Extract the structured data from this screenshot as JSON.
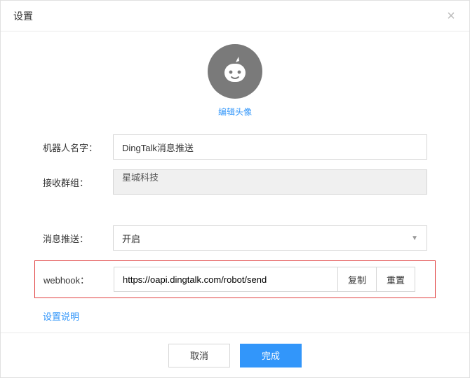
{
  "dialog": {
    "title": "设置",
    "close_icon": "×"
  },
  "avatar": {
    "edit_label": "编辑头像"
  },
  "form": {
    "robot_name_label": "机器人名字：",
    "robot_name_value": "DingTalk消息推送",
    "group_label": "接收群组：",
    "group_value": "星城科技",
    "push_label": "消息推送：",
    "push_value": "开启",
    "webhook_label": "webhook：",
    "webhook_value": "https://oapi.dingtalk.com/robot/send",
    "copy_label": "复制",
    "reset_label": "重置",
    "help_label": "设置说明"
  },
  "footer": {
    "cancel_label": "取消",
    "confirm_label": "完成"
  }
}
